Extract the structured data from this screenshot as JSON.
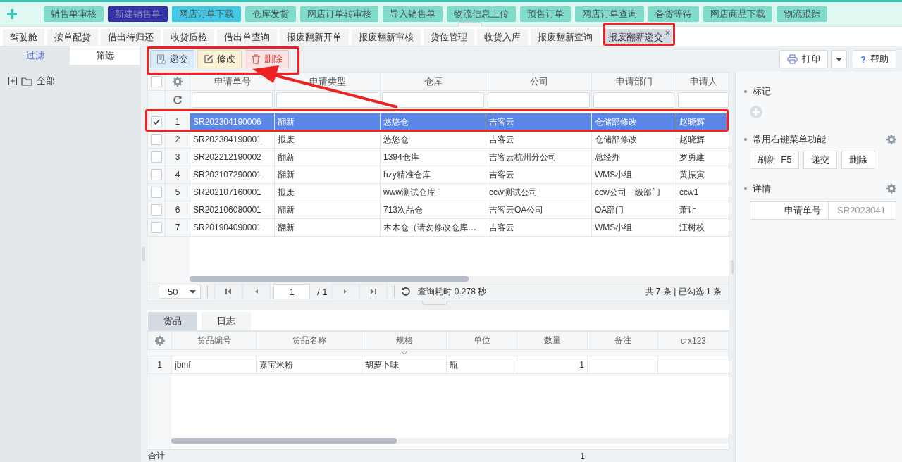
{
  "top_nav": {
    "items": [
      {
        "label": "销售单审核",
        "color": "#7fdccb"
      },
      {
        "label": "新建销售单",
        "color": "#3431a6"
      },
      {
        "label": "网店订单下载",
        "color": "#40c8e6"
      },
      {
        "label": "仓库发货",
        "color": "#7fdccb"
      },
      {
        "label": "网店订单转审核",
        "color": "#7fdccb"
      },
      {
        "label": "导入销售单",
        "color": "#7fdccb"
      },
      {
        "label": "物流信息上传",
        "color": "#7fdccb"
      },
      {
        "label": "预售订单",
        "color": "#7fdccb"
      },
      {
        "label": "网店订单查询",
        "color": "#7fdccb"
      },
      {
        "label": "备货等待",
        "color": "#7fdccb"
      },
      {
        "label": "网店商品下载",
        "color": "#7fdccb"
      },
      {
        "label": "物流跟踪",
        "color": "#7fdccb"
      }
    ]
  },
  "page_tabs": [
    {
      "label": "驾驶舱",
      "selected": false
    },
    {
      "label": "按单配货",
      "selected": false
    },
    {
      "label": "借出待归还",
      "selected": false
    },
    {
      "label": "收货质检",
      "selected": false
    },
    {
      "label": "借出单查询",
      "selected": false
    },
    {
      "label": "报废翻新开单",
      "selected": false
    },
    {
      "label": "报废翻新审核",
      "selected": false
    },
    {
      "label": "货位管理",
      "selected": false
    },
    {
      "label": "收货入库",
      "selected": false
    },
    {
      "label": "报废翻新查询",
      "selected": false
    },
    {
      "label": "报废翻新递交",
      "selected": true
    }
  ],
  "sidebar": {
    "tabs": [
      {
        "label": "过滤",
        "selected": true
      },
      {
        "label": "筛选",
        "selected": false
      }
    ],
    "tree": [
      {
        "label": "全部",
        "expanded": false
      }
    ]
  },
  "toolbar": {
    "actions": [
      {
        "label": "递交",
        "kind": "submit"
      },
      {
        "label": "修改",
        "kind": "edit"
      },
      {
        "label": "删除",
        "kind": "delete"
      }
    ],
    "print": "打印",
    "help": {
      "icon": "?",
      "label": "帮助"
    }
  },
  "grid": {
    "all_selected": false,
    "columns": [
      {
        "label": "申请单号",
        "kind": "text"
      },
      {
        "label": "申请类型",
        "kind": "select"
      },
      {
        "label": "仓库",
        "kind": "text"
      },
      {
        "label": "公司",
        "kind": "text"
      },
      {
        "label": "申请部门",
        "kind": "text"
      },
      {
        "label": "申请人",
        "kind": "text"
      }
    ],
    "rows": [
      {
        "no": "1",
        "selected": true,
        "cells": [
          "SR202304190006",
          "翻新",
          "悠悠仓",
          "吉客云",
          "仓储部修改",
          "赵晓辉"
        ]
      },
      {
        "no": "2",
        "selected": false,
        "cells": [
          "SR202304190001",
          "报废",
          "悠悠仓",
          "吉客云",
          "仓储部修改",
          "赵晓辉"
        ]
      },
      {
        "no": "3",
        "selected": false,
        "cells": [
          "SR202212190002",
          "翻新",
          "1394仓库",
          "吉客云杭州分公司",
          "总经办",
          "罗勇建"
        ]
      },
      {
        "no": "4",
        "selected": false,
        "cells": [
          "SR202107290001",
          "翻新",
          "hzy精准仓库",
          "吉客云",
          "WMS小组",
          "黄振寅"
        ]
      },
      {
        "no": "5",
        "selected": false,
        "cells": [
          "SR202107160001",
          "报废",
          "www测试仓库",
          "ccw测试公司",
          "ccw公司一级部门",
          "ccw1"
        ]
      },
      {
        "no": "6",
        "selected": false,
        "cells": [
          "SR202106080001",
          "翻新",
          "713次品仓",
          "吉客云OA公司",
          "OA部门",
          "萧让"
        ]
      },
      {
        "no": "7",
        "selected": false,
        "cells": [
          "SR201904090001",
          "翻新",
          "木木仓（请勿修改仓库…",
          "吉客云",
          "WMS小组",
          "汪树校"
        ]
      }
    ]
  },
  "pager": {
    "page_size": "50",
    "page": "1",
    "total_pages": "/ 1",
    "query_time": "查询耗时 0.278 秒",
    "summary": "共 7 条 | 已勾选 1 条"
  },
  "detail_tabs": [
    {
      "label": "货品",
      "selected": true
    },
    {
      "label": "日志",
      "selected": false
    }
  ],
  "items_grid": {
    "columns": [
      "货品编号",
      "货品名称",
      "规格",
      "单位",
      "数量",
      "备注",
      "crx123"
    ],
    "rows": [
      {
        "no": "1",
        "cells": [
          "jbmf",
          "嘉宝米粉",
          "胡萝卜味",
          "瓶",
          "1"
        ]
      }
    ],
    "total": {
      "label": "合计",
      "quantity": "1"
    }
  },
  "right_panel": {
    "mark_title": "标记",
    "menu_title": "常用右键菜单功能",
    "menu_buttons": [
      "刷新  F5",
      "递交",
      "删除"
    ],
    "detail_title": "详情",
    "detail_fields": [
      {
        "label": "申请单号",
        "value": "SR2023041"
      }
    ]
  }
}
